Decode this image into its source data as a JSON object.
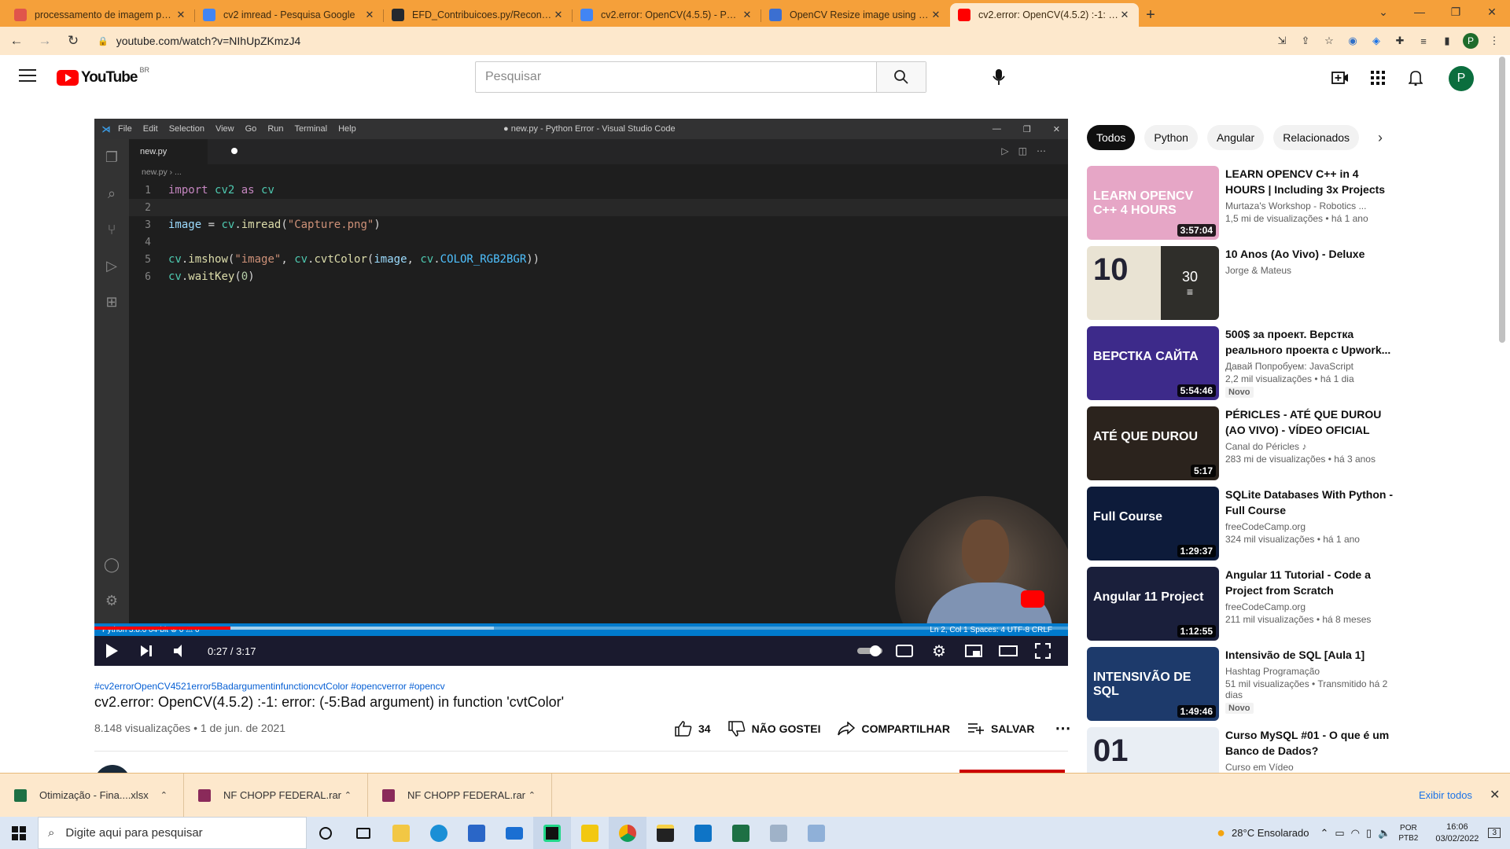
{
  "browser": {
    "tabs": [
      {
        "title": "processamento de imagem para",
        "favicon": "qa-icon",
        "color": "#e0554b"
      },
      {
        "title": "cv2 imread - Pesquisa Google",
        "favicon": "google-icon",
        "color": "#4285f4"
      },
      {
        "title": "EFD_Contribuicoes.py/Reconheci",
        "favicon": "github-icon",
        "color": "#24292f"
      },
      {
        "title": "cv2.error: OpenCV(4.5.5) - Pesqu",
        "favicon": "google-icon",
        "color": "#4285f4"
      },
      {
        "title": "OpenCV Resize image using cv2.",
        "favicon": "site-icon",
        "color": "#3b6fd1"
      },
      {
        "title": "cv2.error: OpenCV(4.5.2) :-1: erro",
        "favicon": "youtube-icon",
        "color": "#ff0000"
      }
    ],
    "active_tab": 5,
    "url": "youtube.com/watch?v=NIhUpZKmzJ4"
  },
  "youtube": {
    "logo_text": "YouTube",
    "region": "BR",
    "search_placeholder": "Pesquisar",
    "avatar_letter": "P"
  },
  "vscode": {
    "menu": [
      "File",
      "Edit",
      "Selection",
      "View",
      "Go",
      "Run",
      "Terminal",
      "Help"
    ],
    "window_title": "● new.py - Python Error - Visual Studio Code",
    "tab": "new.py",
    "breadcrumb": "new.py › ...",
    "status_left": "Python 3.8.6 64-bit   ⊗ 0 ⚠ 0",
    "status_right": "Ln 2, Col 1   Spaces: 4   UTF-8   CRLF"
  },
  "player": {
    "time": "0:27 / 3:17",
    "progress": 0.14,
    "buffered": 0.41
  },
  "video": {
    "tags": "#cv2errorOpenCV4521error5BadargumentinfunctioncvtColor #opencverror #opencv",
    "title": "cv2.error: OpenCV(4.5.2) :-1: error: (-5:Bad argument) in function 'cvtColor'",
    "meta": "8.148 visualizações • 1 de jun. de 2021",
    "likes": "34",
    "dislike": "NÃO GOSTEI",
    "share": "COMPARTILHAR",
    "save": "SALVAR"
  },
  "chips": [
    "Todos",
    "Python",
    "Angular",
    "Relacionados"
  ],
  "recommendations": [
    {
      "title": "LEARN OPENCV C++ in 4 HOURS | Including 3x Projects ...",
      "channel": "Murtaza's Workshop - Robotics ...",
      "views": "1,5 mi de visualizações • há 1 ano",
      "duration": "3:57:04",
      "thumb_text": "LEARN OPENCV C++ 4 HOURS",
      "thumb_color": "#e6a6c6",
      "badge": ""
    },
    {
      "title": "10 Anos (Ao Vivo) - Deluxe",
      "channel": "Jorge & Mateus",
      "views": "",
      "duration": "",
      "playlist_count": "30",
      "thumb_text": "10",
      "thumb_color": "#e9e3d3",
      "badge": ""
    },
    {
      "title": "500$ за проект. Верстка реального проекта с Upwork...",
      "channel": "Давай Попробуем: JavaScript",
      "views": "2,2 mil visualizações • há 1 dia",
      "duration": "5:54:46",
      "thumb_text": "ВЕРСТКА САЙТА",
      "thumb_color": "#3d2a8a",
      "badge": "Novo"
    },
    {
      "title": "PÉRICLES - ATÉ QUE DUROU (AO VIVO) - VÍDEO OFICIAL",
      "channel": "Canal do Péricles ♪",
      "views": "283 mi de visualizações • há 3 anos",
      "duration": "5:17",
      "thumb_text": "ATÉ QUE DUROU",
      "thumb_color": "#2b231d",
      "badge": ""
    },
    {
      "title": "SQLite Databases With Python - Full Course",
      "channel": "freeCodeCamp.org",
      "views": "324 mil visualizações • há 1 ano",
      "duration": "1:29:37",
      "thumb_text": "Full Course",
      "thumb_color": "#0d1b3a",
      "badge": ""
    },
    {
      "title": "Angular 11 Tutorial - Code a Project from Scratch",
      "channel": "freeCodeCamp.org",
      "views": "211 mil visualizações • há 8 meses",
      "duration": "1:12:55",
      "thumb_text": "Angular 11 Project",
      "thumb_color": "#1a1f3b",
      "badge": ""
    },
    {
      "title": "Intensivão de SQL [Aula 1]",
      "channel": "Hashtag Programação",
      "views": "51 mil visualizações • Transmitido há 2 dias",
      "duration": "1:49:46",
      "thumb_text": "INTENSIVÃO DE SQL",
      "thumb_color": "#1d3a6b",
      "badge": "Novo"
    },
    {
      "title": "Curso MySQL #01 - O que é um Banco de Dados?",
      "channel": "Curso em Vídeo",
      "views": "",
      "duration": "",
      "thumb_text": "01",
      "thumb_color": "#e9eef4",
      "badge": ""
    }
  ],
  "downloads": {
    "items": [
      {
        "name": "Otimização - Fina....xlsx",
        "color": "#1d7044"
      },
      {
        "name": "NF CHOPP FEDERAL.rar",
        "color": "#8a2a5a"
      },
      {
        "name": "NF CHOPP FEDERAL.rar",
        "color": "#8a2a5a"
      }
    ],
    "show_all": "Exibir todos"
  },
  "taskbar": {
    "search": "Digite aqui para pesquisar",
    "weather": "28°C  Ensolarado",
    "lang": "POR\nPTB2",
    "time": "16:06",
    "date": "03/02/2022",
    "notif": "3"
  }
}
